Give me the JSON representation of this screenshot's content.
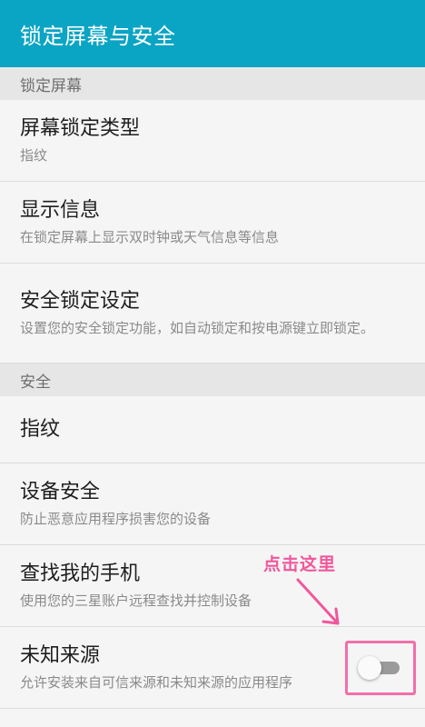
{
  "appbar": {
    "title": "锁定屏幕与安全"
  },
  "sections": {
    "lock_screen": {
      "header": "锁定屏幕",
      "items": [
        {
          "title": "屏幕锁定类型",
          "subtitle": "指纹"
        },
        {
          "title": "显示信息",
          "subtitle": "在锁定屏幕上显示双时钟或天气信息等信息"
        },
        {
          "title": "安全锁定设定",
          "subtitle": "设置您的安全锁定功能，如自动锁定和按电源键立即锁定。"
        }
      ]
    },
    "security": {
      "header": "安全",
      "items": [
        {
          "title": "指纹"
        },
        {
          "title": "设备安全",
          "subtitle": "防止恶意应用程序损害您的设备"
        },
        {
          "title": "查找我的手机",
          "subtitle": "使用您的三星账户远程查找并控制设备"
        },
        {
          "title": "未知来源",
          "subtitle": "允许安装来自可信来源和未知来源的应用程序",
          "toggle_on": false
        }
      ]
    }
  },
  "annotation": {
    "text": "点击这里"
  },
  "colors": {
    "appbar": "#0aa4c4",
    "annotation": "#f0579a",
    "highlight_border": "#f26fa8"
  }
}
